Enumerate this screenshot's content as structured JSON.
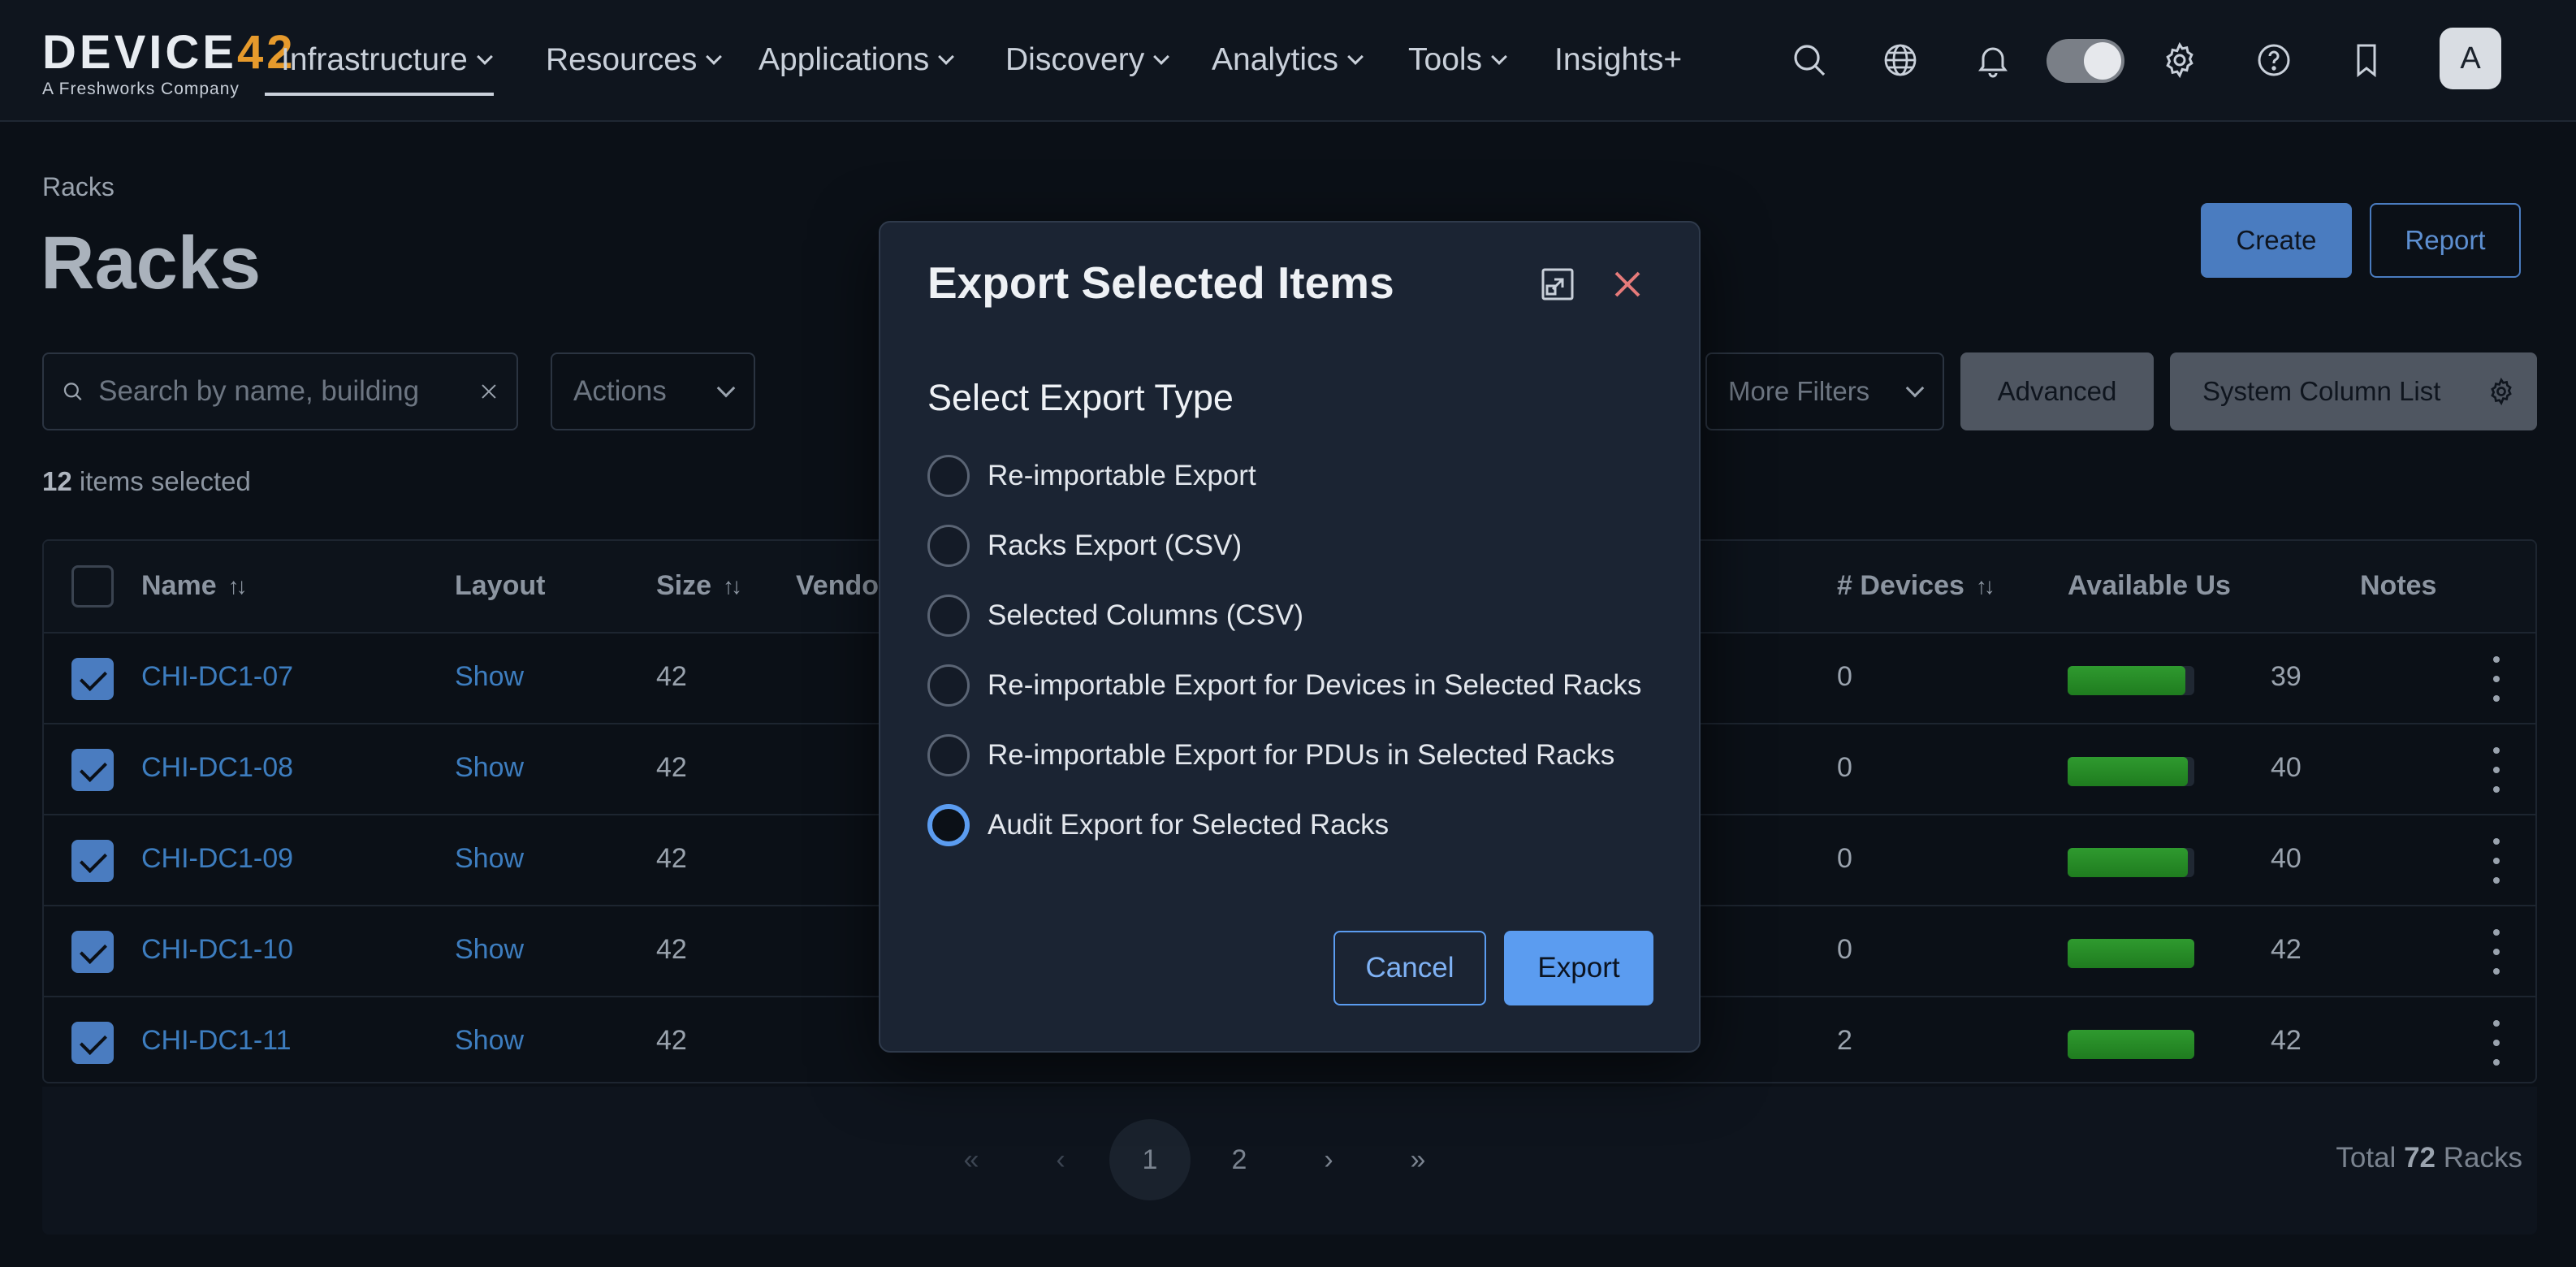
{
  "brand": {
    "name_left": "DEVICE",
    "name_right": "42",
    "tagline": "A Freshworks Company"
  },
  "nav": {
    "items": [
      {
        "label": "Infrastructure",
        "dropdown": true,
        "active": true
      },
      {
        "label": "Resources",
        "dropdown": true
      },
      {
        "label": "Applications",
        "dropdown": true
      },
      {
        "label": "Discovery",
        "dropdown": true
      },
      {
        "label": "Analytics",
        "dropdown": true
      },
      {
        "label": "Tools",
        "dropdown": true
      },
      {
        "label": "Insights+",
        "dropdown": false
      }
    ],
    "icons": [
      "search-icon",
      "globe-icon",
      "bell-icon",
      "theme-toggle",
      "gear-icon",
      "help-icon",
      "bookmark-icon"
    ],
    "avatar_initial": "A"
  },
  "page": {
    "breadcrumb": "Racks",
    "title": "Racks",
    "create_label": "Create",
    "report_label": "Report"
  },
  "filters": {
    "search_placeholder": "Search by name, building",
    "actions_label": "Actions",
    "more_filters_label": "More Filters",
    "advanced_label": "Advanced",
    "system_column_label": "System Column List"
  },
  "selection": {
    "count": "12",
    "suffix": "items selected"
  },
  "table": {
    "headers": {
      "name": "Name",
      "layout": "Layout",
      "size": "Size",
      "vendor": "Vendor",
      "devices": "# Devices",
      "available": "Available Us",
      "notes": "Notes"
    },
    "rows": [
      {
        "name": "CHI-DC1-07",
        "layout": "Show",
        "size": "42",
        "devices": "0",
        "available": "39",
        "fill": 0.93
      },
      {
        "name": "CHI-DC1-08",
        "layout": "Show",
        "size": "42",
        "devices": "0",
        "available": "40",
        "fill": 0.95
      },
      {
        "name": "CHI-DC1-09",
        "layout": "Show",
        "size": "42",
        "devices": "0",
        "available": "40",
        "fill": 0.95
      },
      {
        "name": "CHI-DC1-10",
        "layout": "Show",
        "size": "42",
        "devices": "0",
        "available": "42",
        "fill": 1.0
      },
      {
        "name": "CHI-DC1-11",
        "layout": "Show",
        "size": "42",
        "devices": "2",
        "available": "42",
        "fill": 1.0
      }
    ]
  },
  "pagination": {
    "first": "«",
    "prev": "‹",
    "pages": [
      "1",
      "2"
    ],
    "current": "1",
    "next": "›",
    "last": "»",
    "total_prefix": "Total",
    "total_count": "72",
    "total_suffix": "Racks"
  },
  "modal": {
    "title": "Export Selected Items",
    "subtitle": "Select Export Type",
    "options": [
      {
        "label": "Re-importable Export",
        "selected": false
      },
      {
        "label": "Racks Export (CSV)",
        "selected": false
      },
      {
        "label": "Selected Columns (CSV)",
        "selected": false
      },
      {
        "label": "Re-importable Export for Devices in Selected Racks",
        "selected": false
      },
      {
        "label": "Re-importable Export for PDUs in Selected Racks",
        "selected": false
      },
      {
        "label": "Audit Export for Selected Racks",
        "selected": true
      }
    ],
    "cancel_label": "Cancel",
    "export_label": "Export"
  },
  "colors": {
    "accent": "#5b9cf0",
    "link": "#3d7dbf",
    "bar_green": "#2f9a2f",
    "logo_orange": "#e69a2c"
  }
}
